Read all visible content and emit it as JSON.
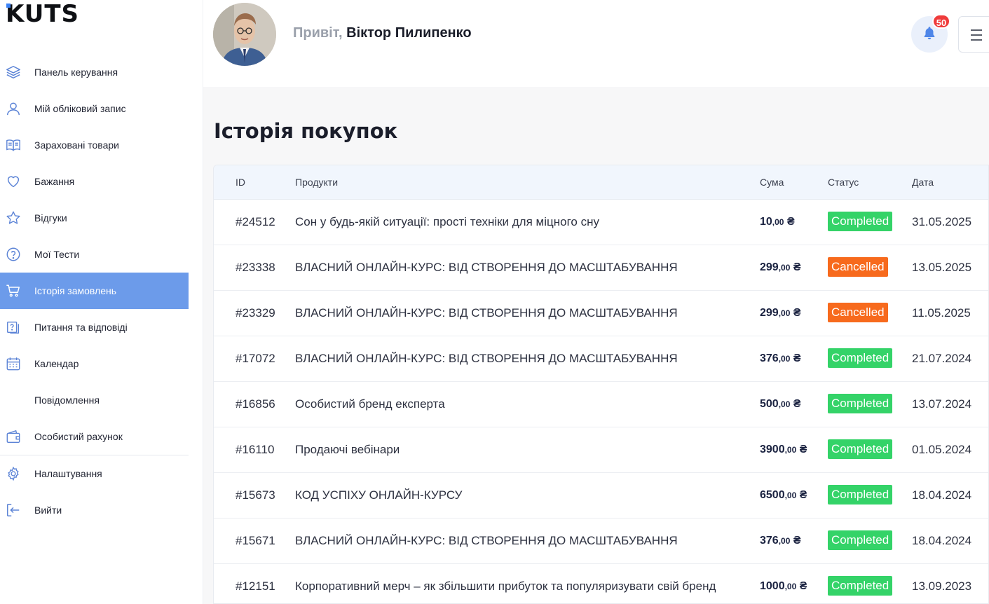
{
  "brand": {
    "logo": "KUTS",
    "accent": "#3b82f6"
  },
  "sidebar": {
    "items": [
      {
        "label": "Панель керування",
        "icon": "layers-icon"
      },
      {
        "label": "Мій обліковий запис",
        "icon": "user-icon"
      },
      {
        "label": "Зараховані товари",
        "icon": "book-open-icon"
      },
      {
        "label": "Бажання",
        "icon": "heart-icon"
      },
      {
        "label": "Відгуки",
        "icon": "star-icon"
      },
      {
        "label": "Мої Тести",
        "icon": "help-circle-icon"
      },
      {
        "label": "Історія замовлень",
        "icon": "cart-icon",
        "active": true
      },
      {
        "label": "Питання та відповіді",
        "icon": "question-doc-icon"
      },
      {
        "label": "Календар",
        "icon": "calendar-icon"
      },
      {
        "label": "Повідомлення",
        "icon": ""
      },
      {
        "label": "Особистий рахунок",
        "icon": "wallet-icon"
      },
      {
        "label": "Налаштування",
        "icon": "gear-icon"
      },
      {
        "label": "Вийти",
        "icon": "logout-icon"
      }
    ],
    "active_color": "#6c9bea"
  },
  "header": {
    "greeting": "Привіт,",
    "user_name": "Віктор Пилипенко",
    "notifications_count": "50"
  },
  "main": {
    "title": "Історія покупок",
    "columns": [
      "ID",
      "Продукти",
      "Сума",
      "Статус",
      "Дата"
    ],
    "currency": "₴",
    "orders": [
      {
        "id": "#24512",
        "product": "Сон у будь-якій ситуації: прості техніки для міцного сну",
        "amount": "10",
        "decimals": ",00",
        "status": "Completed",
        "date": "31.05.2025"
      },
      {
        "id": "#23338",
        "product": "ВЛАСНИЙ ОНЛАЙН-КУРС: ВІД СТВОРЕННЯ ДО МАСШТАБУВАННЯ",
        "amount": "299",
        "decimals": ",00",
        "status": "Cancelled",
        "date": "13.05.2025"
      },
      {
        "id": "#23329",
        "product": "ВЛАСНИЙ ОНЛАЙН-КУРС: ВІД СТВОРЕННЯ ДО МАСШТАБУВАННЯ",
        "amount": "299",
        "decimals": ",00",
        "status": "Cancelled",
        "date": "11.05.2025"
      },
      {
        "id": "#17072",
        "product": "ВЛАСНИЙ ОНЛАЙН-КУРС: ВІД СТВОРЕННЯ ДО МАСШТАБУВАННЯ",
        "amount": "376",
        "decimals": ",00",
        "status": "Completed",
        "date": "21.07.2024"
      },
      {
        "id": "#16856",
        "product": "Особистий бренд експерта",
        "amount": "500",
        "decimals": ",00",
        "status": "Completed",
        "date": "13.07.2024"
      },
      {
        "id": "#16110",
        "product": "Продаючі вебінари",
        "amount": "3900",
        "decimals": ",00",
        "status": "Completed",
        "date": "01.05.2024"
      },
      {
        "id": "#15673",
        "product": "КОД УСПІХУ ОНЛАЙН-КУРСУ",
        "amount": "6500",
        "decimals": ",00",
        "status": "Completed",
        "date": "18.04.2024"
      },
      {
        "id": "#15671",
        "product": "ВЛАСНИЙ ОНЛАЙН-КУРС: ВІД СТВОРЕННЯ ДО МАСШТАБУВАННЯ",
        "amount": "376",
        "decimals": ",00",
        "status": "Completed",
        "date": "18.04.2024"
      },
      {
        "id": "#12151",
        "product": "Корпоративний мерч – як збільшити прибуток та популяризувати свій бренд",
        "amount": "1000",
        "decimals": ",00",
        "status": "Completed",
        "date": "13.09.2023"
      }
    ],
    "status_colors": {
      "Completed": "#34d368",
      "Cancelled": "#f76a1d"
    }
  }
}
